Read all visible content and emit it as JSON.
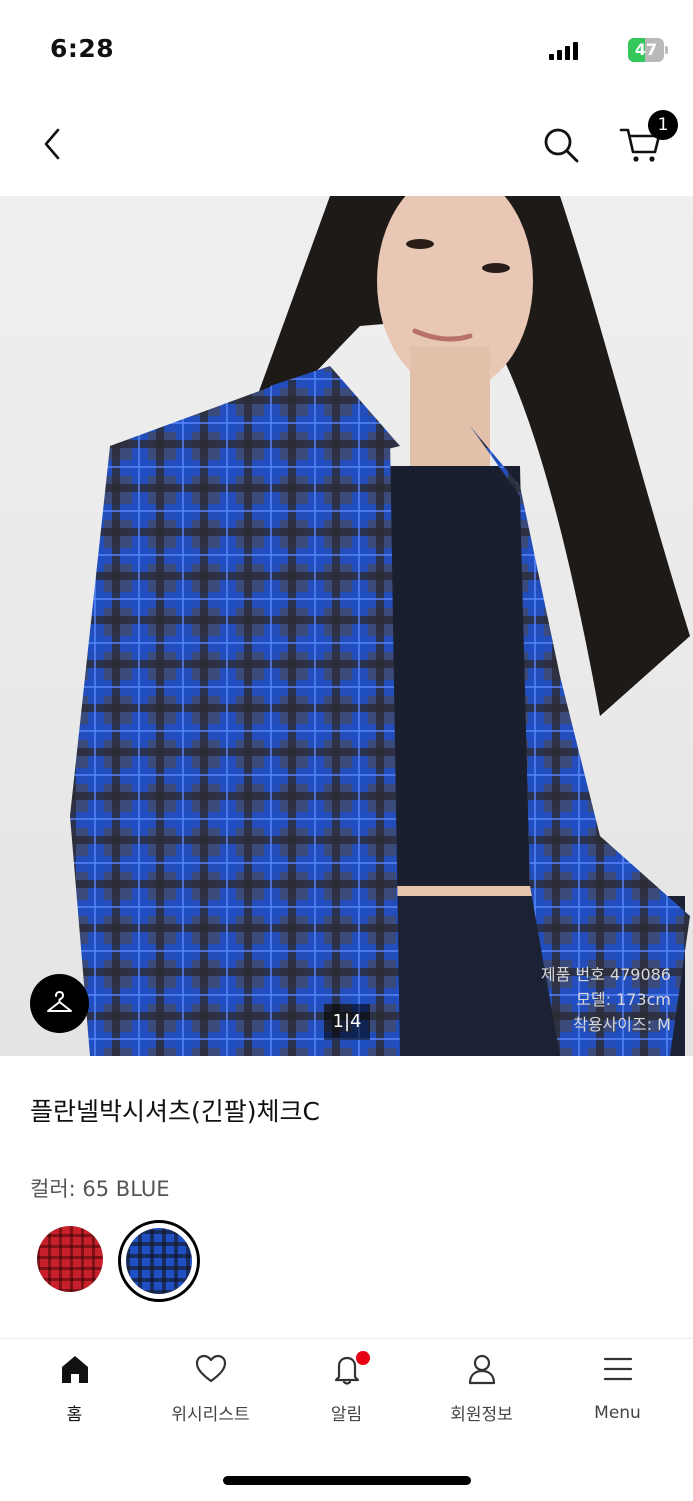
{
  "status_bar": {
    "time": "6:28",
    "battery": "47",
    "battery_level": 0.47
  },
  "header": {
    "back_icon": "chevron-left-icon",
    "search_icon": "search-icon",
    "cart_icon": "cart-icon",
    "cart_count": "1"
  },
  "hero": {
    "pager": "1|4",
    "model_info": {
      "product_no": "제품 번호 479086",
      "model": "모델: 173cm",
      "size": "착용사이즈: M"
    }
  },
  "product": {
    "title": "플란넬박시셔츠(긴팔)체크C",
    "color_label": "컬러: 65 BLUE",
    "swatches": [
      {
        "name": "red-check",
        "color": "#c8202a",
        "selected": false
      },
      {
        "name": "blue-check",
        "color": "#1f4fc4",
        "selected": true
      }
    ]
  },
  "tabbar": {
    "items": [
      {
        "label": "홈",
        "icon": "home-icon"
      },
      {
        "label": "위시리스트",
        "icon": "heart-icon"
      },
      {
        "label": "알림",
        "icon": "bell-icon"
      },
      {
        "label": "회원정보",
        "icon": "user-icon"
      },
      {
        "label": "Menu",
        "icon": "menu-icon"
      }
    ]
  },
  "colors": {
    "accent": "#e60012",
    "text": "#111111"
  }
}
